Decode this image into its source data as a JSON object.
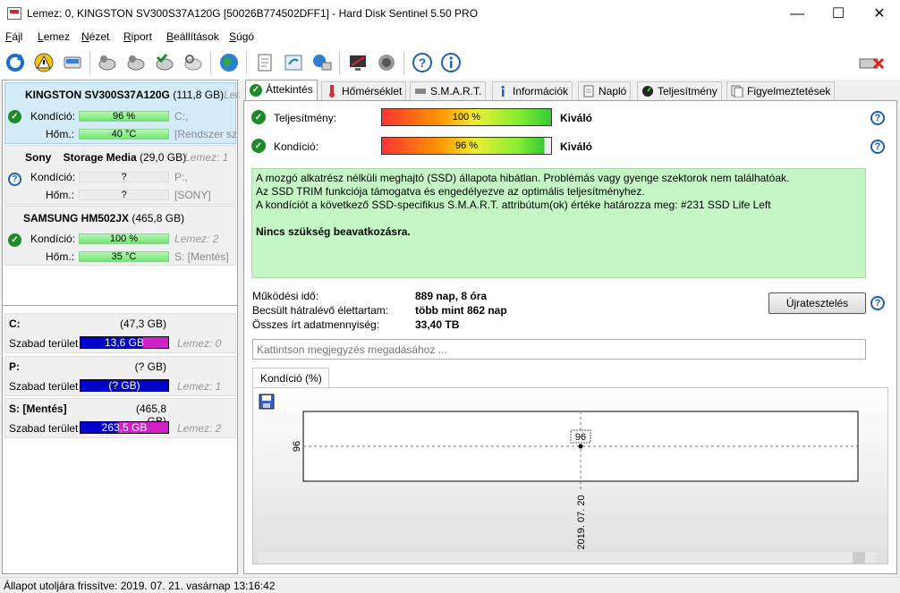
{
  "window": {
    "title": "Lemez: 0, KINGSTON SV300S37A120G [50026B774502DFF1]  -  Hard Disk Sentinel 5.50 PRO",
    "minimize": "—",
    "maximize": "☐",
    "close": "✕"
  },
  "menu": [
    "Fájl",
    "Lemez",
    "Nézet",
    "Riport",
    "Beállítások",
    "Súgó"
  ],
  "disks": [
    {
      "name": "KINGSTON SV300S37A120G",
      "size": "(111,8 GB)",
      "disk_label": "Lemez",
      "health_label": "Kondíció:",
      "health_value": "96 %",
      "health_pct": 96,
      "temp_label": "Hőm.:",
      "temp_value": "40 °C",
      "side1": "C:,",
      "side2": "[Rendszer szá",
      "status": "ok"
    },
    {
      "name": "Sony    Storage Media",
      "size": "(29,0 GB)",
      "disk_label": "Lemez: 1",
      "health_label": "Kondíció:",
      "health_value": "?",
      "temp_label": "Hőm.:",
      "temp_value": "?",
      "side1": "P:,",
      "side2": "[SONY]",
      "status": "unknown"
    },
    {
      "name": "SAMSUNG HM502JX",
      "size": "(465,8 GB)",
      "disk_label": "",
      "health_label": "Kondíció:",
      "health_value": "100 %",
      "health_pct": 100,
      "temp_label": "Hőm.:",
      "temp_value": "35 °C",
      "side1": "Lemez: 2",
      "side2": "S: [Mentés]",
      "status": "ok"
    }
  ],
  "volumes": [
    {
      "name": "C:",
      "size": "(47,3 GB)",
      "free_label": "Szabad terület",
      "free": "13,6 GB",
      "used_fraction": 0.29,
      "disk": "Lemez: 0"
    },
    {
      "name": "P:",
      "size": "(? GB)",
      "free_label": "Szabad terület",
      "free": "(? GB)",
      "used_fraction": 0,
      "disk": "Lemez: 1"
    },
    {
      "name": "S: [Mentés]",
      "size": "(465,8 GB)",
      "free_label": "Szabad terület",
      "free": "263,5 GB",
      "used_fraction": 0.57,
      "disk": "Lemez: 2"
    }
  ],
  "tabs": [
    "Áttekintés",
    "Hőmérséklet",
    "S.M.A.R.T.",
    "Információk",
    "Napló",
    "Teljesítmény",
    "Figyelmeztetések"
  ],
  "overview": {
    "performance_label": "Teljesítmény:",
    "performance_value": "100 %",
    "performance_pct": 100,
    "performance_rating": "Kiváló",
    "health_label": "Kondíció:",
    "health_value": "96 %",
    "health_pct": 96,
    "health_rating": "Kiváló",
    "message_lines": [
      "A mozgó alkatrész nélküli meghajtó (SSD) állapota hibátlan. Problémás vagy gyenge szektorok nem találhatóak.",
      "Az SSD TRIM funkciója támogatva és engedélyezve az optimális teljesítményhez.",
      "A kondíciót a következő SSD-specifikus S.M.A.R.T. attribútum(ok) értéke határozza meg:  #231 SSD Life Left"
    ],
    "message_bold": "Nincs szükség beavatkozásra.",
    "uptime_label": "Működési idő:",
    "uptime_value": "889 nap, 8 óra",
    "lifetime_label": "Becsült hátralévő élettartam:",
    "lifetime_value": "több mint 862 nap",
    "written_label": "Összes írt adatmennyiség:",
    "written_value": "33,40 TB",
    "restart_button": "Újratesztelés",
    "note_placeholder": "Kattintson megjegyzés megadásához ..."
  },
  "chart_tab": "Kondíció  (%)",
  "chart_data": {
    "type": "line",
    "x": [
      "2019. 07. 20"
    ],
    "series": [
      {
        "values": [
          96
        ]
      }
    ],
    "data_labels": [
      "96"
    ],
    "ytick": "96",
    "xtick": "2019. 07. 20"
  },
  "statusbar": "Állapot utoljára frissítve: 2019. 07. 21. vasárnap 13:16:42"
}
